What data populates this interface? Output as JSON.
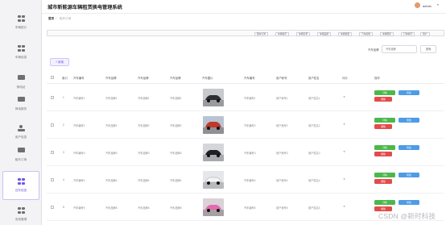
{
  "header": {
    "title": "城市新能源车辆租赁换电管理系统",
    "user_name": "admin",
    "user_caret": "▾"
  },
  "sidebar": {
    "items": [
      {
        "label": "车辆统计"
      },
      {
        "label": "车辆信息"
      },
      {
        "label": "换电站"
      },
      {
        "label": "换电服务"
      },
      {
        "label": "用户信息"
      },
      {
        "label": "租车订单"
      },
      {
        "label": "还车信息"
      },
      {
        "label": "系统管理"
      }
    ]
  },
  "breadcrumb": {
    "home": "首页",
    "sep": "/",
    "current": "租车订单"
  },
  "filters": [
    "租车订单",
    "车辆编号",
    "车辆名称",
    "车辆品牌",
    "车辆类型",
    "汽车颜色",
    "车辆图片",
    "订单编号",
    "用户"
  ],
  "search": {
    "label": "汽车品牌",
    "placeholder": "汽车品牌",
    "button": "查询"
  },
  "add_button": "+ 新增",
  "table": {
    "headers": [
      "索引",
      "汽车编号",
      "汽车品牌",
      "汽车品牌",
      "汽车品牌",
      "汽车图片",
      "汽车编号",
      "用户帐号",
      "用户姓名",
      "评分",
      "操作"
    ],
    "rows": [
      {
        "index": "1",
        "c1": "汽车编号1",
        "c2": "汽车品牌1",
        "c3": "汽车品牌1",
        "c4": "汽车品牌1",
        "c6": "汽车编号1",
        "c7": "用户帐号1",
        "c8": "用户姓名1",
        "rating": "★"
      },
      {
        "index": "2",
        "c1": "汽车编号2",
        "c2": "汽车品牌2",
        "c3": "汽车品牌2",
        "c4": "汽车品牌2",
        "c6": "汽车编号2",
        "c7": "用户帐号2",
        "c8": "用户姓名2",
        "rating": "★"
      },
      {
        "index": "3",
        "c1": "汽车编号3",
        "c2": "汽车品牌3",
        "c3": "汽车品牌3",
        "c4": "汽车品牌3",
        "c6": "汽车编号3",
        "c7": "用户帐号3",
        "c8": "用户姓名3",
        "rating": "★"
      },
      {
        "index": "4",
        "c1": "汽车编号4",
        "c2": "汽车品牌4",
        "c3": "汽车品牌4",
        "c4": "汽车品牌4",
        "c6": "汽车编号4",
        "c7": "用户帐号4",
        "c8": "用户姓名4",
        "rating": "★"
      },
      {
        "index": "5",
        "c1": "汽车编号5",
        "c2": "汽车品牌5",
        "c3": "汽车品牌5",
        "c4": "汽车品牌5",
        "c6": "汽车编号5",
        "c7": "用户帐号5",
        "c8": "用户姓名5",
        "rating": "★"
      }
    ],
    "actions": {
      "view": "详情",
      "edit": "修改",
      "delete": "删除"
    }
  },
  "watermark": "CSDN @新时科技",
  "colors": {
    "accent": "#6f55e6",
    "view": "#4cb84c",
    "edit": "#4e9be6",
    "delete": "#e34b4b"
  }
}
